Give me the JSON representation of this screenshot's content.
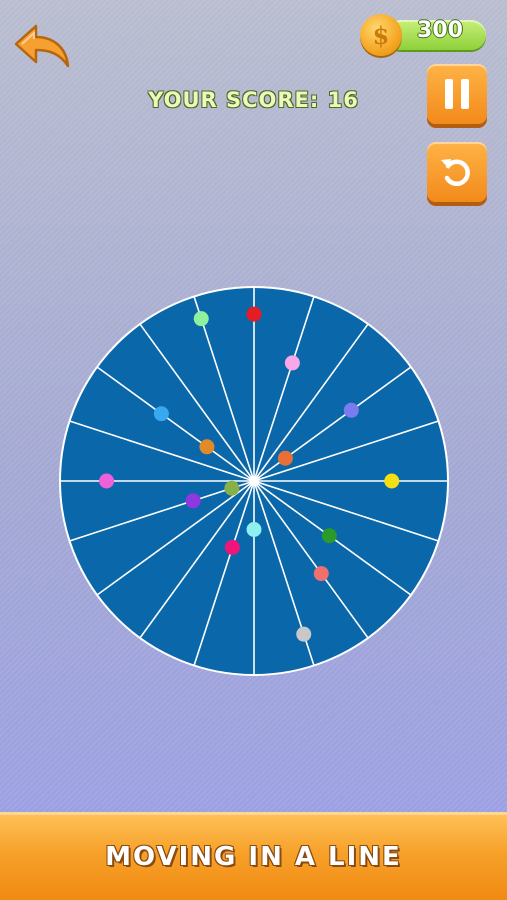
{
  "header": {
    "back_icon": "back-arrow-icon",
    "coins": "300",
    "coin_symbol": "$",
    "score_text": "YOUR SCORE: 16"
  },
  "controls": {
    "pause_icon": "pause-icon",
    "restart_icon": "restart-icon"
  },
  "wheel": {
    "color": "#0a67a9",
    "spoke_color": "#ffffff",
    "spoke_count": 20,
    "balls": [
      {
        "color": "#8ff0a0",
        "spoke_index": 19,
        "distance": 0.88
      },
      {
        "color": "#e51c23",
        "spoke_index": 0,
        "distance": 0.86
      },
      {
        "color": "#f8a8e8",
        "spoke_index": 1,
        "distance": 0.64
      },
      {
        "color": "#7b7bf0",
        "spoke_index": 3,
        "distance": 0.62
      },
      {
        "color": "#e87038",
        "spoke_index": 3,
        "distance": 0.2
      },
      {
        "color": "#f4e012",
        "spoke_index": 5,
        "distance": 0.71
      },
      {
        "color": "#2a9a2a",
        "spoke_index": 7,
        "distance": 0.48
      },
      {
        "color": "#f07070",
        "spoke_index": 8,
        "distance": 0.59
      },
      {
        "color": "#c8c8c8",
        "spoke_index": 9,
        "distance": 0.83
      },
      {
        "color": "#8ff0f0",
        "spoke_index": 10,
        "distance": 0.25
      },
      {
        "color": "#f0157a",
        "spoke_index": 11,
        "distance": 0.36
      },
      {
        "color": "#9038e0",
        "spoke_index": 14,
        "distance": 0.33
      },
      {
        "color": "#88b048",
        "spoke_index": 14,
        "distance": 0.12
      },
      {
        "color": "#f060d8",
        "spoke_index": 15,
        "distance": 0.76
      },
      {
        "color": "#38a8f0",
        "spoke_index": 17,
        "distance": 0.59
      },
      {
        "color": "#e08a2a",
        "spoke_index": 17,
        "distance": 0.3
      }
    ]
  },
  "footer": {
    "title": "MOVING IN A LINE"
  }
}
